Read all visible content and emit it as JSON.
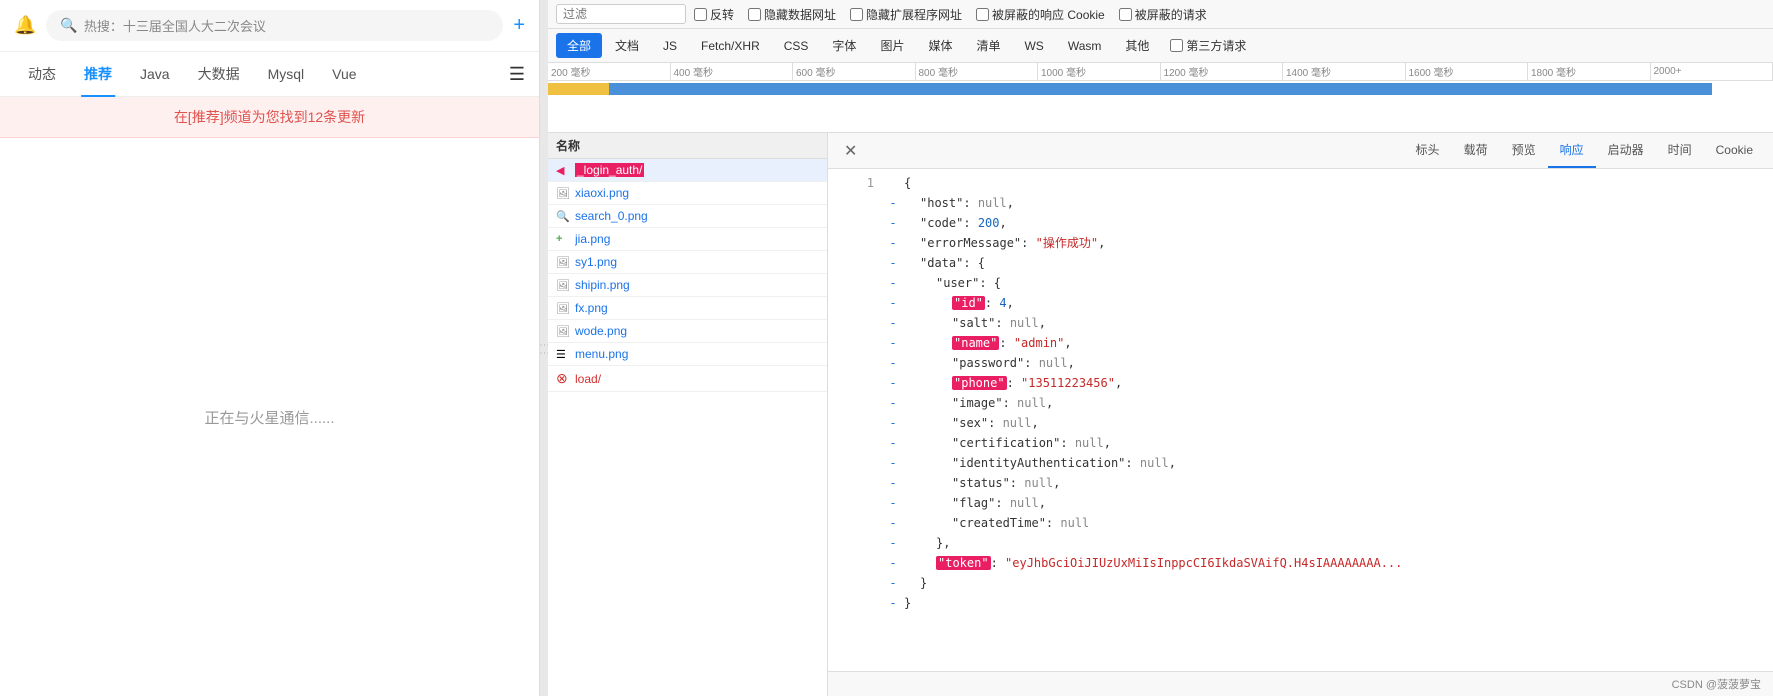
{
  "left": {
    "bell_icon": "🔔",
    "search_placeholder": "热搜：十三届全国人大二次会议",
    "add_icon": "+",
    "nav_tabs": [
      {
        "label": "动态",
        "active": false
      },
      {
        "label": "推荐",
        "active": true
      },
      {
        "label": "Java",
        "active": false
      },
      {
        "label": "大数据",
        "active": false
      },
      {
        "label": "Mysql",
        "active": false
      },
      {
        "label": "Vue",
        "active": false
      }
    ],
    "update_banner": "在[推荐]频道为您找到12条更新",
    "content_text": "正在与火星通信......"
  },
  "devtools": {
    "filter_placeholder": "过滤",
    "checkboxes": [
      {
        "label": "反转",
        "checked": false
      },
      {
        "label": "隐藏数据网址",
        "checked": false
      },
      {
        "label": "隐藏扩展程序网址",
        "checked": false
      }
    ],
    "type_tabs": [
      {
        "label": "全部",
        "active": true
      },
      {
        "label": "文档",
        "active": false
      },
      {
        "label": "JS",
        "active": false
      },
      {
        "label": "Fetch/XHR",
        "active": false
      },
      {
        "label": "CSS",
        "active": false
      },
      {
        "label": "字体",
        "active": false
      },
      {
        "label": "图片",
        "active": false
      },
      {
        "label": "媒体",
        "active": false
      },
      {
        "label": "清单",
        "active": false
      },
      {
        "label": "WS",
        "active": false
      },
      {
        "label": "Wasm",
        "active": false
      },
      {
        "label": "其他",
        "active": false
      }
    ],
    "extra_checkboxes": [
      {
        "label": "被屏蔽的响应 Cookie",
        "checked": false
      },
      {
        "label": "被屏蔽的请求",
        "checked": false
      }
    ],
    "third_party_checkbox": {
      "label": "第三方请求",
      "checked": false
    },
    "timeline": {
      "marks": [
        "200 毫秒",
        "400 毫秒",
        "600 毫秒",
        "800 毫秒",
        "1000 毫秒",
        "1200 毫秒",
        "1400 毫秒",
        "1600 毫秒",
        "1800 毫秒",
        "2000+"
      ]
    },
    "list_header": "名称",
    "requests": [
      {
        "icon": "folder",
        "name": "_login_auth/",
        "selected": true,
        "type": "folder"
      },
      {
        "icon": "image",
        "name": "xiaoxi.png",
        "selected": false,
        "type": "image"
      },
      {
        "icon": "search",
        "name": "search_0.png",
        "selected": false,
        "type": "image"
      },
      {
        "icon": "plus",
        "name": "jia.png",
        "selected": false,
        "type": "image"
      },
      {
        "icon": "image",
        "name": "sy1.png",
        "selected": false,
        "type": "image"
      },
      {
        "icon": "image",
        "name": "shipin.png",
        "selected": false,
        "type": "image"
      },
      {
        "icon": "image",
        "name": "fx.png",
        "selected": false,
        "type": "image"
      },
      {
        "icon": "image",
        "name": "wode.png",
        "selected": false,
        "type": "image"
      },
      {
        "icon": "menu",
        "name": "menu.png",
        "selected": false,
        "type": "image"
      },
      {
        "icon": "error",
        "name": "load/",
        "selected": false,
        "type": "error"
      }
    ],
    "detail_tabs": [
      {
        "label": "标头",
        "active": false
      },
      {
        "label": "载荷",
        "active": false
      },
      {
        "label": "预览",
        "active": false
      },
      {
        "label": "响应",
        "active": true
      },
      {
        "label": "启动器",
        "active": false
      },
      {
        "label": "时间",
        "active": false
      },
      {
        "label": "Cookie",
        "active": false
      }
    ],
    "json_response": {
      "lines": [
        {
          "num": 1,
          "dash": "",
          "content": "{",
          "type": "brace"
        },
        {
          "num": "",
          "dash": "-",
          "content": "\"host\": null,",
          "key": "host",
          "val": "null"
        },
        {
          "num": "",
          "dash": "-",
          "content": "\"code\": 200,",
          "key": "code",
          "val": "200"
        },
        {
          "num": "",
          "dash": "-",
          "content": "\"errorMessage\": \"操作成功\",",
          "key": "errorMessage",
          "val": "\"操作成功\""
        },
        {
          "num": "",
          "dash": "-",
          "content": "\"data\": {",
          "key": "data",
          "val": "{"
        },
        {
          "num": "",
          "dash": "-",
          "content": "\"user\": {",
          "key": "user",
          "val": "{",
          "indent": 4
        },
        {
          "num": "",
          "dash": "-",
          "content": "\"id\": 4,",
          "key": "id",
          "val": "4",
          "highlight": true,
          "indent": 8
        },
        {
          "num": "",
          "dash": "-",
          "content": "\"salt\": null,",
          "key": "salt",
          "val": "null",
          "indent": 8
        },
        {
          "num": "",
          "dash": "-",
          "content": "\"name\": \"admin\",",
          "key": "name",
          "val": "\"admin\"",
          "highlight_key": true,
          "indent": 8
        },
        {
          "num": "",
          "dash": "-",
          "content": "\"password\": null,",
          "key": "password",
          "val": "null",
          "indent": 8
        },
        {
          "num": "",
          "dash": "-",
          "content": "\"phone\": \"13511223456\",",
          "key": "phone",
          "val": "\"13511223456\"",
          "highlight_key": true,
          "indent": 8
        },
        {
          "num": "",
          "dash": "-",
          "content": "\"image\": null,",
          "key": "image",
          "val": "null",
          "indent": 8
        },
        {
          "num": "",
          "dash": "-",
          "content": "\"sex\": null,",
          "key": "sex",
          "val": "null",
          "indent": 8
        },
        {
          "num": "",
          "dash": "-",
          "content": "\"certification\": null,",
          "key": "certification",
          "val": "null",
          "indent": 8
        },
        {
          "num": "",
          "dash": "-",
          "content": "\"identityAuthentication\": null,",
          "key": "identityAuthentication",
          "val": "null",
          "indent": 8
        },
        {
          "num": "",
          "dash": "-",
          "content": "\"status\": null,",
          "key": "status",
          "val": "null",
          "indent": 8
        },
        {
          "num": "",
          "dash": "-",
          "content": "\"flag\": null,",
          "key": "flag",
          "val": "null",
          "indent": 8
        },
        {
          "num": "",
          "dash": "-",
          "content": "\"createdTime\": null",
          "key": "createdTime",
          "val": "null",
          "indent": 8
        },
        {
          "num": "",
          "dash": "-",
          "content": "},",
          "type": "close",
          "indent": 4
        },
        {
          "num": "",
          "dash": "-",
          "content": "\"token\": \"eyJhbGciOiJIUzUxMiIsInppcCI6IkdaSVAifQ.H4sIAAAAAAAA...",
          "key": "token",
          "val": "\"eyJhbGciOiJIUzUxMiIsInppcCI6IkdaSVAifQ.H4sIAAAAAAAA",
          "highlight_key": true,
          "indent": 4
        },
        {
          "num": "",
          "dash": "-",
          "content": "}",
          "type": "close",
          "indent": 2
        },
        {
          "num": "",
          "dash": "-",
          "content": "}",
          "type": "close",
          "indent": 0
        }
      ]
    }
  },
  "bottom_bar": "CSDN @菠菠萝宝"
}
